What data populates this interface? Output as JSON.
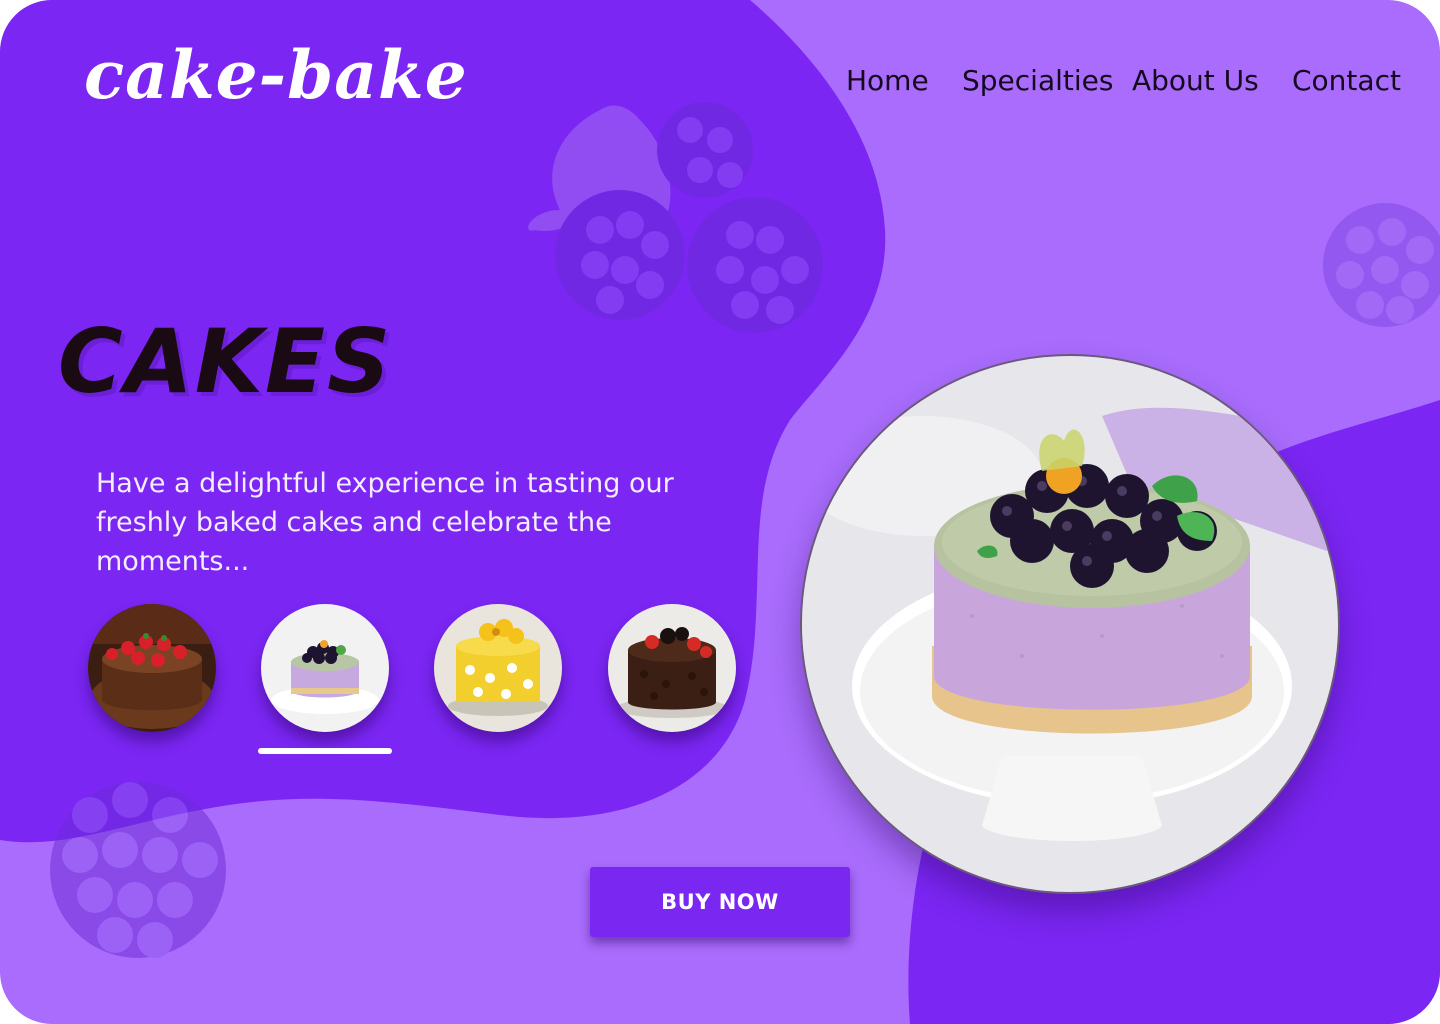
{
  "brand": {
    "logo": "cake-bake"
  },
  "nav": {
    "items": [
      {
        "label": "Home"
      },
      {
        "label": "Specialties"
      },
      {
        "label": "About Us"
      },
      {
        "label": "Contact"
      }
    ]
  },
  "hero": {
    "heading": "CAKES",
    "description": "Have a delightful experience in tasting our freshly baked cakes and celebrate the moments...",
    "cta_label": "BUY NOW"
  },
  "carousel": {
    "selected_index": 1,
    "items": [
      {
        "icon": "chocolate-strawberry-cake-icon"
      },
      {
        "icon": "blackberry-mousse-cake-icon"
      },
      {
        "icon": "yellow-flower-cake-icon"
      },
      {
        "icon": "chocolate-oreo-cake-icon"
      }
    ]
  },
  "colors": {
    "background_light": "#a96cfc",
    "background_dark": "#7b26f3",
    "accent_text": "#ffffff",
    "heading": "#1a0a14"
  },
  "decorations": [
    "blackberry-icon",
    "leaf-icon"
  ]
}
